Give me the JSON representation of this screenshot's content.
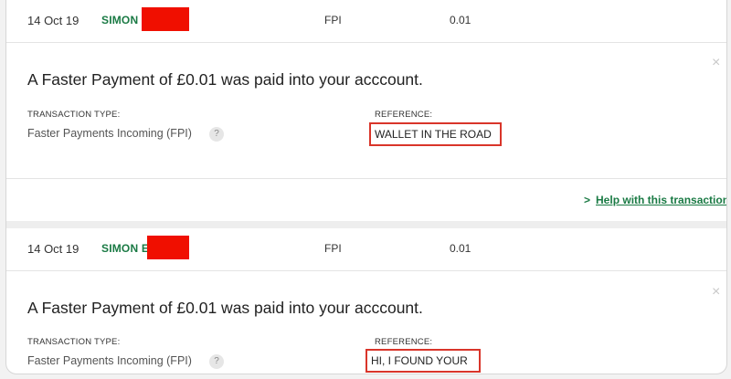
{
  "transactions": [
    {
      "date": "14 Oct 19",
      "payee": "SIMON",
      "type": "FPI",
      "amount": "0.01",
      "message": "A Faster Payment of £0.01 was paid into your acccount.",
      "transaction_type_label": "TRANSACTION TYPE:",
      "transaction_type_value": "Faster Payments Incoming (FPI)",
      "reference_label": "REFERENCE:",
      "reference_value": "WALLET IN THE ROAD",
      "help_link": "Help with this transaction"
    },
    {
      "date": "14 Oct 19",
      "payee": "SIMON E",
      "type": "FPI",
      "amount": "0.01",
      "message": "A Faster Payment of £0.01 was paid into your acccount.",
      "transaction_type_label": "TRANSACTION TYPE:",
      "transaction_type_value": "Faster Payments Incoming (FPI)",
      "reference_label": "REFERENCE:",
      "reference_value": "HI, I FOUND YOUR"
    }
  ],
  "help_icon": "?",
  "close_icon": "×",
  "chevron_icon": ">",
  "colors": {
    "payee_green": "#1a7a44",
    "redaction_red": "#f00f00",
    "highlight_red": "#d9352a"
  }
}
